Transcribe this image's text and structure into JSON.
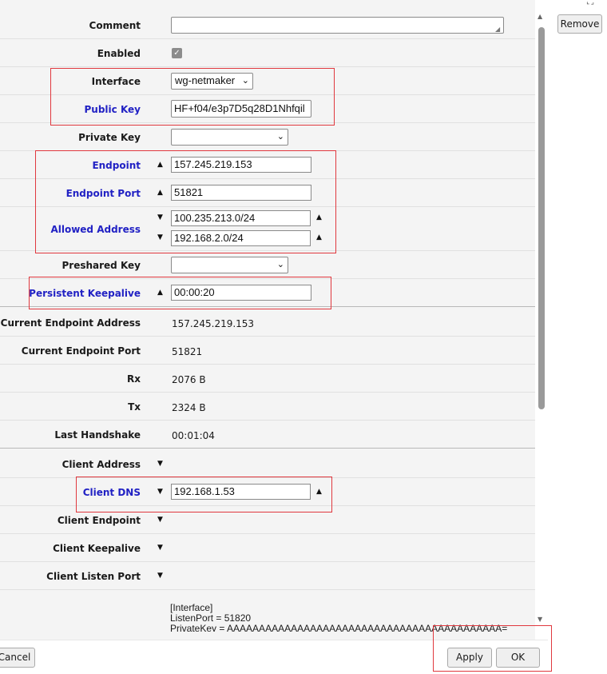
{
  "fields": {
    "comment_label": "Comment",
    "comment_value": "",
    "enabled_label": "Enabled",
    "enabled_checked": true,
    "interface_label": "Interface",
    "interface_value": "wg-netmaker",
    "public_key_label": "Public Key",
    "public_key_value": "HF+f04/e3p7D5q28D1Nhfqil",
    "private_key_label": "Private Key",
    "private_key_value": "",
    "endpoint_label": "Endpoint",
    "endpoint_value": "157.245.219.153",
    "endpoint_port_label": "Endpoint Port",
    "endpoint_port_value": "51821",
    "allowed_address_label": "Allowed Address",
    "allowed_addresses": [
      "100.235.213.0/24",
      "192.168.2.0/24"
    ],
    "preshared_key_label": "Preshared Key",
    "preshared_key_value": "",
    "persistent_keepalive_label": "Persistent Keepalive",
    "persistent_keepalive_value": "00:00:20"
  },
  "status": {
    "current_endpoint_address_label": "Current Endpoint Address",
    "current_endpoint_address_value": "157.245.219.153",
    "current_endpoint_port_label": "Current Endpoint Port",
    "current_endpoint_port_value": "51821",
    "rx_label": "Rx",
    "rx_value": "2076 B",
    "tx_label": "Tx",
    "tx_value": "2324 B",
    "last_handshake_label": "Last Handshake",
    "last_handshake_value": "00:01:04"
  },
  "client": {
    "client_address_label": "Client Address",
    "client_dns_label": "Client DNS",
    "client_dns_value": "192.168.1.53",
    "client_endpoint_label": "Client Endpoint",
    "client_keepalive_label": "Client Keepalive",
    "client_listen_port_label": "Client Listen Port",
    "config_lines": [
      "[Interface]",
      "ListenPort = 51820",
      "PrivateKey = AAAAAAAAAAAAAAAAAAAAAAAAAAAAAAAAAAAAAAAAAAA="
    ]
  },
  "buttons": {
    "remove": "Remove",
    "cancel": "Cancel",
    "apply": "Apply",
    "ok": "OK"
  },
  "colors": {
    "highlight_border": "#e0383e",
    "changed_label": "#2121c4"
  }
}
